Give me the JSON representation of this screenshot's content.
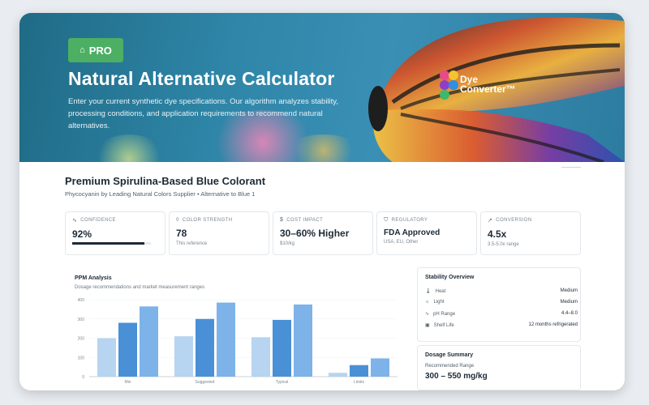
{
  "hero": {
    "badge": "PRO",
    "title": "Natural Alternative Calculator",
    "description": "Enter your current synthetic dye specifications. Our algorithm analyzes stability, processing conditions, and application requirements to recommend natural alternatives.",
    "logo_line1": "Dye",
    "logo_line2": "Converter™"
  },
  "product": {
    "title": "Premium Spirulina-Based Blue Colorant",
    "subtitle": "Phycocyanin by Leading Natural Colors Supplier • Alternative to Blue 1"
  },
  "metrics": [
    {
      "label": "CONFIDENCE",
      "icon": "pulse-icon",
      "value": "92%",
      "sub": "",
      "progress": 0.92
    },
    {
      "label": "COLOR STRENGTH",
      "icon": "drop-icon",
      "value": "78",
      "sub": "This reference"
    },
    {
      "label": "COST IMPACT",
      "icon": "dollar-icon",
      "value": "30–60% Higher",
      "sub": "$10/kg"
    },
    {
      "label": "REGULATORY",
      "icon": "shield-icon",
      "value": "FDA Approved",
      "sub": "USA, EU, Other"
    },
    {
      "label": "CONVERSION",
      "icon": "trend-icon",
      "value": "4.5x",
      "sub": "3.5-5.0x range"
    }
  ],
  "chart": {
    "title": "PPM Analysis",
    "subtitle": "Dosage recommendations and market measurement ranges"
  },
  "chart_data": {
    "type": "bar",
    "categories": [
      "Min",
      "Suggested",
      "Typical",
      "Limits"
    ],
    "series": [
      {
        "values": [
          200,
          210,
          205,
          20
        ]
      },
      {
        "values": [
          280,
          300,
          295,
          60
        ]
      },
      {
        "values": [
          365,
          385,
          375,
          95
        ]
      }
    ],
    "yticks": [
      "400",
      "300",
      "200",
      "100",
      "0"
    ],
    "ylim": [
      0,
      400
    ],
    "colors": [
      "#b7d4f0",
      "#4a90d6",
      "#7db3e8"
    ]
  },
  "stability": {
    "title": "Stability Overview",
    "rows": [
      {
        "icon": "thermometer-icon",
        "label": "Heat",
        "value": "Medium"
      },
      {
        "icon": "sun-icon",
        "label": "Light",
        "value": "Medium"
      },
      {
        "icon": "ph-icon",
        "label": "pH Range",
        "value": "4.4–8.0"
      },
      {
        "icon": "calendar-icon",
        "label": "Shelf Life",
        "value": "12 months refrigerated"
      }
    ]
  },
  "dosage": {
    "title": "Dosage Summary",
    "label": "Recommended Range",
    "value": "300 – 550 mg/kg"
  }
}
